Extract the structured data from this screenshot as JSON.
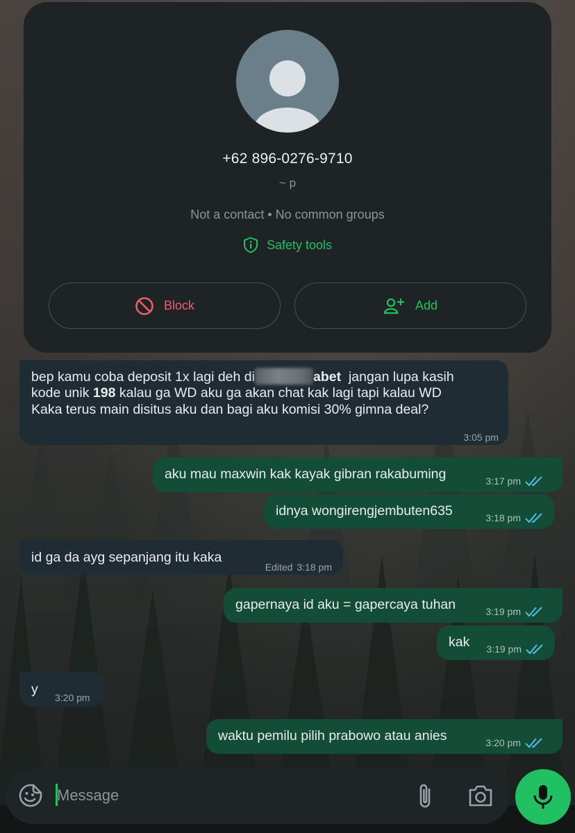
{
  "contact_card": {
    "phone": "+62 896-0276-9710",
    "push_name": "~ p",
    "status": "Not a contact • No common groups",
    "safety_label": "Safety tools",
    "block_label": "Block",
    "add_label": "Add"
  },
  "messages": [
    {
      "direction": "incoming",
      "line1_a": "bep kamu coba deposit 1x lagi deh di",
      "line1_b": "abet",
      "line1_c": "jangan lupa kasih",
      "line2_a": "kode unik ",
      "line2_bold": "198",
      "line2_b": " kalau ga WD aku ga akan chat kak lagi tapi kalau WD",
      "line3": "Kaka terus main disitus aku dan bagi aku komisi 30% gimna deal?",
      "time": "3:05 pm"
    },
    {
      "direction": "outgoing",
      "text": "aku mau maxwin kak kayak gibran rakabuming",
      "time": "3:17 pm"
    },
    {
      "direction": "outgoing",
      "text": "idnya wongirengjembuten635",
      "time": "3:18 pm"
    },
    {
      "direction": "incoming",
      "text": "id ga da ayg sepanjang itu kaka",
      "edited": "Edited",
      "time": "3:18 pm"
    },
    {
      "direction": "outgoing",
      "text": "gapernaya id aku = gapercaya tuhan",
      "time": "3:19 pm"
    },
    {
      "direction": "outgoing",
      "text": "kak",
      "time": "3:19 pm"
    },
    {
      "direction": "incoming",
      "text": "y",
      "time": "3:20 pm"
    },
    {
      "direction": "outgoing",
      "text": "waktu pemilu pilih prabowo atau anies",
      "time": "3:20 pm"
    }
  ],
  "input": {
    "placeholder": "Message"
  },
  "colors": {
    "accent": "#21c063",
    "block_red": "#f15c6d",
    "incoming_bubble": "#1f2c33",
    "outgoing_bubble": "#134d37",
    "read_ticks": "#53bdeb"
  },
  "icons": [
    "sticker-icon",
    "attach-icon",
    "camera-icon",
    "mic-icon",
    "shield-icon",
    "block-icon",
    "add-person-icon",
    "double-check-icon"
  ]
}
